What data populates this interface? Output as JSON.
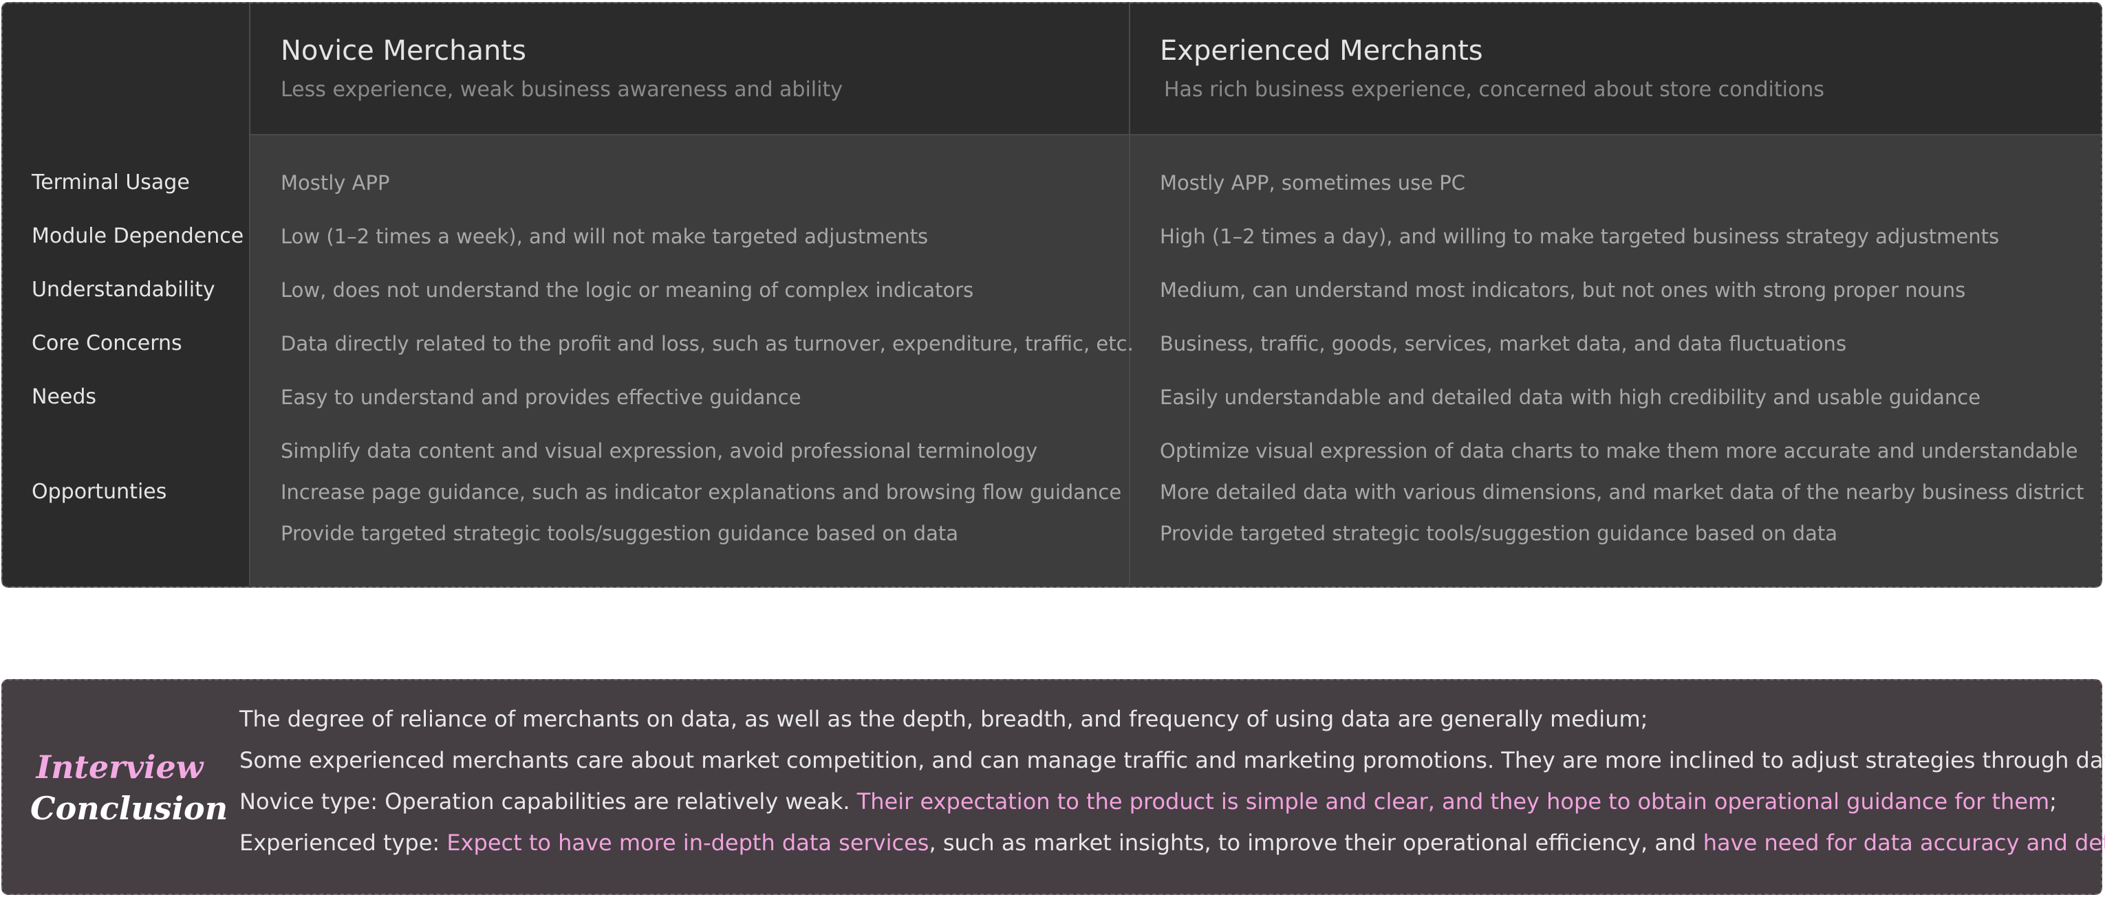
{
  "columns": {
    "novice": {
      "title": "Novice Merchants",
      "subtitle": "Less experience, weak business awareness and ability"
    },
    "experienced": {
      "title": "Experienced Merchants",
      "subtitle": "Has rich business experience, concerned about store conditions"
    }
  },
  "rows": [
    {
      "label": "Terminal Usage",
      "novice": "Mostly APP",
      "experienced": "Mostly APP, sometimes use PC"
    },
    {
      "label": "Module Dependence",
      "novice": "Low (1–2 times a week), and will not make targeted adjustments",
      "experienced": "High (1–2 times a day), and willing to make targeted business strategy adjustments"
    },
    {
      "label": "Understandability",
      "novice": "Low, does not understand the logic or meaning of complex indicators",
      "experienced": "Medium, can understand most indicators, but not ones with strong proper nouns"
    },
    {
      "label": "Core Concerns",
      "novice": "Data directly related to the profit and loss, such as turnover, expenditure, traffic, etc.",
      "experienced": "Business, traffic, goods, services, market data, and data fluctuations"
    },
    {
      "label": "Needs",
      "novice": "Easy to understand and provides effective guidance",
      "experienced": "Easily understandable and detailed data with high credibility and usable guidance"
    }
  ],
  "opportunities": {
    "label": "Opportunties",
    "novice": [
      "Simplify data content and visual expression, avoid professional terminology",
      "Increase page guidance, such as indicator explanations and browsing flow guidance",
      "Provide targeted strategic tools/suggestion guidance based on data"
    ],
    "experienced": [
      "Optimize visual expression of data charts to make them more accurate and understandable",
      "More detailed data with various dimensions, and market data of the nearby business district",
      "Provide targeted strategic tools/suggestion guidance based on data"
    ]
  },
  "conclusion": {
    "badge_line1": "Interview",
    "badge_line2": "Conclusion",
    "line1": "The degree of reliance of merchants on data, as well as the depth, breadth, and frequency of using data are generally medium;",
    "line2": "Some experienced merchants care about market competition, and can manage traffic and marketing promotions. They are more inclined to adjust strategies through data;",
    "line3": {
      "a": "Novice type: Operation capabilities are relatively weak. ",
      "b": "Their expectation to the product is simple and clear, and they hope to obtain operational guidance for them",
      "c": ";"
    },
    "line4": {
      "a": "Experienced type: ",
      "b": "Expect to have more in-depth data services",
      "c": ", such as market insights, to improve their operational efficiency, and ",
      "d": "have need for data accuracy and detail",
      "e": "."
    }
  },
  "colors": {
    "table_bg": "#3d3d3d",
    "header_bg": "#2b2b2b",
    "conclusion_bg": "#453e43",
    "highlight": "#f0a3dd"
  }
}
